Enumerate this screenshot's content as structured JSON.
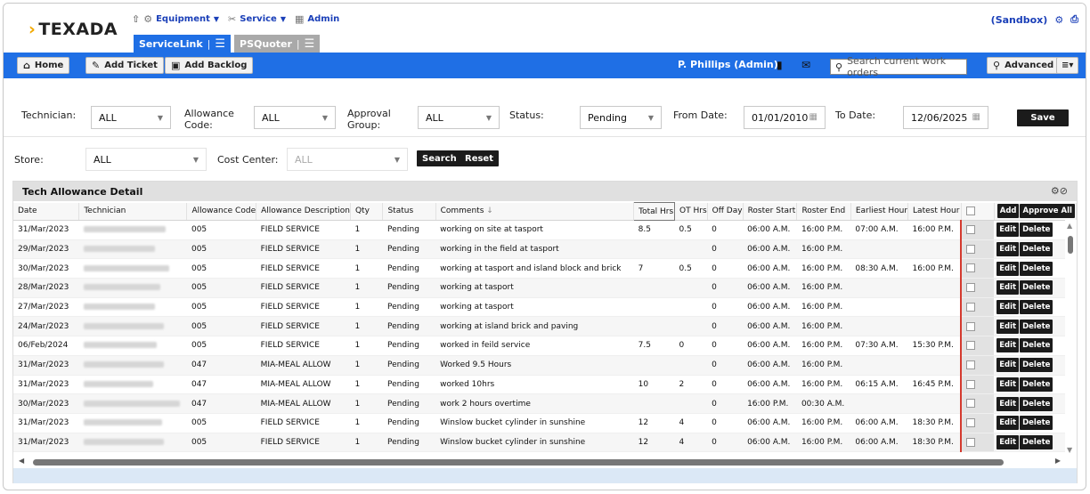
{
  "brand": {
    "logo_text": "TEXADA",
    "logo_mark": "›"
  },
  "topnav": {
    "items": [
      {
        "label": "Equipment",
        "icon": "equipment-icon"
      },
      {
        "label": "Service",
        "icon": "service-icon"
      },
      {
        "label": "Admin",
        "icon": "admin-icon"
      }
    ]
  },
  "apptabs": [
    {
      "label": "ServiceLink",
      "active": true
    },
    {
      "label": "PSQuoter",
      "active": false
    }
  ],
  "sandbox_label": "(Sandbox)",
  "toolbar": {
    "home": "Home",
    "add_ticket": "Add Ticket",
    "add_backlog": "Add Backlog",
    "user": "P. Phillips (Admin)",
    "search_placeholder": "Search current work orders",
    "advanced": "Advanced"
  },
  "filters": {
    "technician_label": "Technician:",
    "technician_value": "ALL",
    "allowance_label": "Allowance Code:",
    "allowance_value": "ALL",
    "approval_label": "Approval Group:",
    "approval_value": "ALL",
    "status_label": "Status:",
    "status_value": "Pending",
    "from_label": "From Date:",
    "from_value": "01/01/2010",
    "to_label": "To Date:",
    "to_value": "12/06/2025",
    "save": "Save",
    "store_label": "Store:",
    "store_value": "ALL",
    "cost_label": "Cost Center:",
    "cost_value": "ALL",
    "search": "Search",
    "reset": "Reset"
  },
  "panel": {
    "title": "Tech Allowance Detail",
    "columns": [
      "Date",
      "Technician",
      "Allowance Code",
      "Allowance Description",
      "Qty",
      "Status",
      "Comments",
      "Total Hrs",
      "OT Hrs",
      "Off Day",
      "Roster Start",
      "Roster End",
      "Earliest Hour",
      "Latest Hour"
    ],
    "comments_sort": "↓",
    "add_label": "Add",
    "approve_all_label": "Approve All",
    "edit_label": "Edit",
    "delete_label": "Delete",
    "rows": [
      {
        "date": "31/Mar/2023",
        "code": "005",
        "desc": "FIELD SERVICE",
        "qty": "1",
        "status": "Pending",
        "comments": "working on site at tasport",
        "total": "8.5",
        "ot": "0.5",
        "off": "0",
        "rs": "06:00 A.M.",
        "re": "16:00 P.M.",
        "eh": "07:00 A.M.",
        "lh": "16:00 P.M."
      },
      {
        "date": "29/Mar/2023",
        "code": "005",
        "desc": "FIELD SERVICE",
        "qty": "1",
        "status": "Pending",
        "comments": "working in the field at tasport",
        "total": "",
        "ot": "",
        "off": "0",
        "rs": "06:00 A.M.",
        "re": "16:00 P.M.",
        "eh": "",
        "lh": ""
      },
      {
        "date": "30/Mar/2023",
        "code": "005",
        "desc": "FIELD SERVICE",
        "qty": "1",
        "status": "Pending",
        "comments": "working at tasport and island block and brick",
        "total": "7",
        "ot": "0.5",
        "off": "0",
        "rs": "06:00 A.M.",
        "re": "16:00 P.M.",
        "eh": "08:30 A.M.",
        "lh": "16:00 P.M."
      },
      {
        "date": "28/Mar/2023",
        "code": "005",
        "desc": "FIELD SERVICE",
        "qty": "1",
        "status": "Pending",
        "comments": "working at tasport",
        "total": "",
        "ot": "",
        "off": "0",
        "rs": "06:00 A.M.",
        "re": "16:00 P.M.",
        "eh": "",
        "lh": ""
      },
      {
        "date": "27/Mar/2023",
        "code": "005",
        "desc": "FIELD SERVICE",
        "qty": "1",
        "status": "Pending",
        "comments": "working at tasport",
        "total": "",
        "ot": "",
        "off": "0",
        "rs": "06:00 A.M.",
        "re": "16:00 P.M.",
        "eh": "",
        "lh": ""
      },
      {
        "date": "24/Mar/2023",
        "code": "005",
        "desc": "FIELD SERVICE",
        "qty": "1",
        "status": "Pending",
        "comments": "working at island brick and paving",
        "total": "",
        "ot": "",
        "off": "0",
        "rs": "06:00 A.M.",
        "re": "16:00 P.M.",
        "eh": "",
        "lh": ""
      },
      {
        "date": "06/Feb/2024",
        "code": "005",
        "desc": "FIELD SERVICE",
        "qty": "1",
        "status": "Pending",
        "comments": "worked in feild service",
        "total": "7.5",
        "ot": "0",
        "off": "0",
        "rs": "06:00 A.M.",
        "re": "16:00 P.M.",
        "eh": "07:30 A.M.",
        "lh": "15:30 P.M."
      },
      {
        "date": "31/Mar/2023",
        "code": "047",
        "desc": "MIA-MEAL ALLOW",
        "qty": "1",
        "status": "Pending",
        "comments": "Worked 9.5 Hours",
        "total": "",
        "ot": "",
        "off": "0",
        "rs": "06:00 A.M.",
        "re": "16:00 P.M.",
        "eh": "",
        "lh": ""
      },
      {
        "date": "31/Mar/2023",
        "code": "047",
        "desc": "MIA-MEAL ALLOW",
        "qty": "1",
        "status": "Pending",
        "comments": "worked 10hrs",
        "total": "10",
        "ot": "2",
        "off": "0",
        "rs": "06:00 A.M.",
        "re": "16:00 P.M.",
        "eh": "06:15 A.M.",
        "lh": "16:45 P.M."
      },
      {
        "date": "30/Mar/2023",
        "code": "047",
        "desc": "MIA-MEAL ALLOW",
        "qty": "1",
        "status": "Pending",
        "comments": "work 2 hours overtime",
        "total": "",
        "ot": "",
        "off": "0",
        "rs": "16:00 P.M.",
        "re": "00:30 A.M.",
        "eh": "",
        "lh": ""
      },
      {
        "date": "31/Mar/2023",
        "code": "005",
        "desc": "FIELD SERVICE",
        "qty": "1",
        "status": "Pending",
        "comments": "Winslow bucket cylinder in sunshine",
        "total": "12",
        "ot": "4",
        "off": "0",
        "rs": "06:00 A.M.",
        "re": "16:00 P.M.",
        "eh": "06:00 A.M.",
        "lh": "18:30 P.M."
      },
      {
        "date": "31/Mar/2023",
        "code": "005",
        "desc": "FIELD SERVICE",
        "qty": "1",
        "status": "Pending",
        "comments": "Winslow bucket cylinder in sunshine",
        "total": "12",
        "ot": "4",
        "off": "0",
        "rs": "06:00 A.M.",
        "re": "16:00 P.M.",
        "eh": "06:00 A.M.",
        "lh": "18:30 P.M."
      }
    ]
  }
}
